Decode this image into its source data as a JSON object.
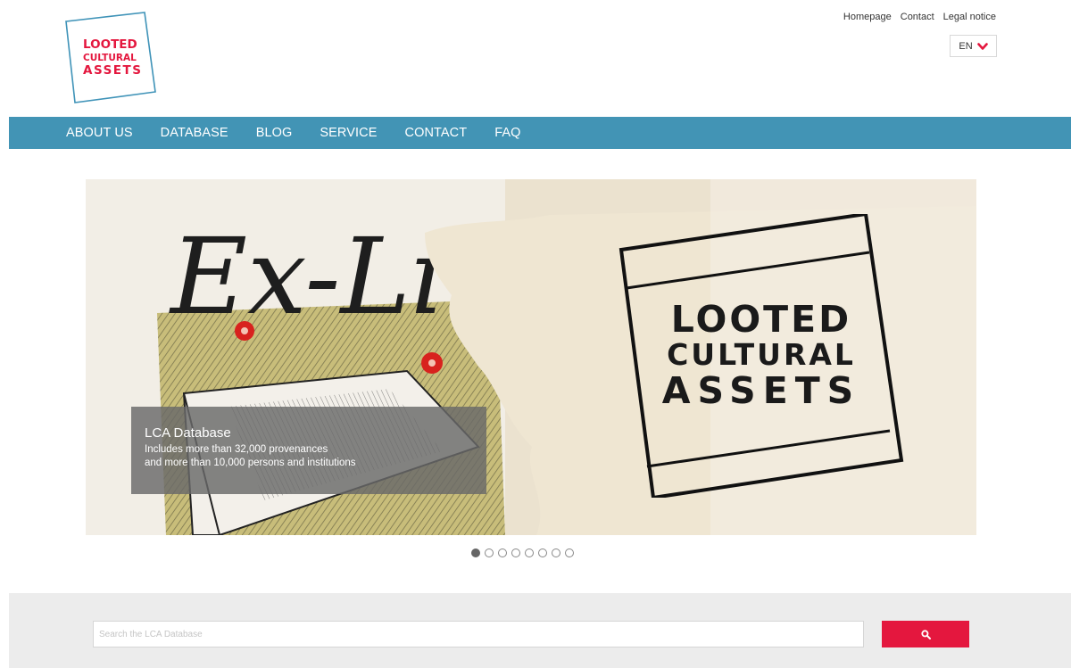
{
  "site": {
    "logo_lines": [
      "LOOTED",
      "CULTURAL",
      "ASSETS"
    ]
  },
  "top_links": [
    {
      "label": "Homepage"
    },
    {
      "label": "Contact"
    },
    {
      "label": "Legal notice"
    }
  ],
  "language": {
    "selected": "EN",
    "icon": "chevron-down-icon"
  },
  "nav": {
    "items": [
      {
        "label": "ABOUT US"
      },
      {
        "label": "DATABASE"
      },
      {
        "label": "BLOG"
      },
      {
        "label": "SERVICE"
      },
      {
        "label": "CONTACT"
      },
      {
        "label": "FAQ"
      }
    ]
  },
  "hero": {
    "caption": {
      "title": "LCA Database",
      "lines": [
        "Includes more than 32,000 provenances",
        "and more than 10,000 persons and institutions"
      ]
    },
    "badge_lines": [
      "LOOTED",
      "CULTURAL",
      "ASSETS"
    ],
    "artwork_script": "Ex-Li",
    "slides_count": 8,
    "active_slide": 1
  },
  "search": {
    "placeholder": "Search the LCA Database",
    "value": "",
    "button_icon": "search-icon"
  },
  "colors": {
    "nav_bar": "#4294b5",
    "accent_red": "#e4173e",
    "logo_blue": "#3f93b8",
    "search_band": "#ececec"
  }
}
